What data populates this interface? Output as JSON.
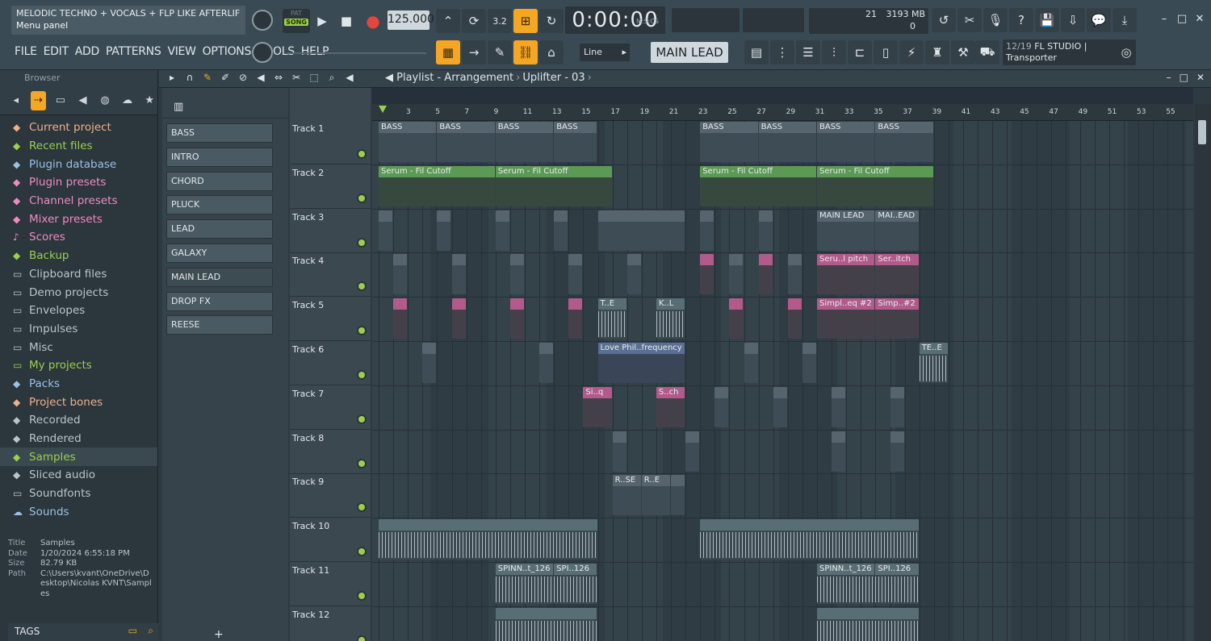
{
  "window": {
    "project_title": "MELODIC TECHNO + VOCALS + FLP LIKE AFTERLIFE,",
    "panel_hint": "Menu panel"
  },
  "transport": {
    "pat_label": "PAT",
    "song_label": "SONG",
    "tempo": "125.000",
    "time": "0:00:00",
    "time_unit": "M:S:CS",
    "cpu_poly": "21",
    "memory": "3193 MB",
    "mem_extra": "0",
    "counter_label": "3.2"
  },
  "menu": [
    "FILE",
    "EDIT",
    "ADD",
    "PATTERNS",
    "VIEW",
    "OPTIONS",
    "TOOLS",
    "HELP"
  ],
  "snap": {
    "value": "Line"
  },
  "sequence": {
    "value": "MAIN LEAD"
  },
  "hint_panel": {
    "counter": "12/19",
    "text1": "FL STUDIO |",
    "text2": "Transporter"
  },
  "browser": {
    "title": "Browser",
    "items": [
      {
        "label": "Current project",
        "icon": "project-icon",
        "color": "#f0b08a"
      },
      {
        "label": "Recent files",
        "icon": "recent-files-icon",
        "color": "#9ccf4e"
      },
      {
        "label": "Plugin database",
        "icon": "plugin-icon",
        "color": "#9bc0e6"
      },
      {
        "label": "Plugin presets",
        "icon": "plugin-presets-icon",
        "color": "#f08bc2"
      },
      {
        "label": "Channel presets",
        "icon": "channel-presets-icon",
        "color": "#f08bc2"
      },
      {
        "label": "Mixer presets",
        "icon": "mixer-presets-icon",
        "color": "#f08bc2"
      },
      {
        "label": "Scores",
        "icon": "note-icon",
        "color": "#f08bc2"
      },
      {
        "label": "Backup",
        "icon": "backup-icon",
        "color": "#9ccf4e"
      },
      {
        "label": "Clipboard files",
        "icon": "folder-icon",
        "color": "#b9c5cb"
      },
      {
        "label": "Demo projects",
        "icon": "folder-icon",
        "color": "#b9c5cb"
      },
      {
        "label": "Envelopes",
        "icon": "folder-icon",
        "color": "#b9c5cb"
      },
      {
        "label": "Impulses",
        "icon": "folder-icon",
        "color": "#b9c5cb"
      },
      {
        "label": "Misc",
        "icon": "folder-icon",
        "color": "#b9c5cb"
      },
      {
        "label": "My projects",
        "icon": "folder-icon",
        "color": "#9ccf4e"
      },
      {
        "label": "Packs",
        "icon": "packs-icon",
        "color": "#9bc0e6"
      },
      {
        "label": "Project bones",
        "icon": "project-bones-icon",
        "color": "#f0b08a"
      },
      {
        "label": "Recorded",
        "icon": "recorded-icon",
        "color": "#b9c5cb"
      },
      {
        "label": "Rendered",
        "icon": "rendered-icon",
        "color": "#b9c5cb"
      },
      {
        "label": "Samples",
        "icon": "samples-icon",
        "color": "#9ccf4e"
      },
      {
        "label": "Sliced audio",
        "icon": "sliced-audio-icon",
        "color": "#b9c5cb"
      },
      {
        "label": "Soundfonts",
        "icon": "folder-icon",
        "color": "#b9c5cb"
      },
      {
        "label": "Sounds",
        "icon": "cloud-icon",
        "color": "#9bc0e6"
      }
    ],
    "selected_index": 18,
    "info": {
      "title_k": "Title",
      "title_v": "Samples",
      "date_k": "Date",
      "date_v": "1/20/2024 6:55:18 PM",
      "size_k": "Size",
      "size_v": "82.79 KB",
      "path_k": "Path",
      "path_v": "C:\\Users\\kvant\\OneDrive\\Desktop\\Nicolas KVNT\\Samples"
    },
    "tags_label": "TAGS"
  },
  "playlist": {
    "title": "Playlist - Arrangement",
    "pattern": "Uplifter - 03",
    "ruler": [
      "3",
      "5",
      "7",
      "9",
      "11",
      "13",
      "15",
      "17",
      "19",
      "21",
      "23",
      "25",
      "27",
      "29",
      "31",
      "33",
      "35",
      "37",
      "39",
      "41",
      "43",
      "45",
      "47",
      "49",
      "51",
      "53",
      "55"
    ],
    "picker": [
      "BASS",
      "INTRO",
      "CHORD",
      "PLUCK",
      "LEAD",
      "GALAXY",
      "MAIN LEAD",
      "DROP FX",
      "REESE"
    ],
    "picker_selected": 6,
    "tracks": [
      "Track 1",
      "Track 2",
      "Track 3",
      "Track 4",
      "Track 5",
      "Track 6",
      "Track 7",
      "Track 8",
      "Track 9",
      "Track 10",
      "Track 11",
      "Track 12"
    ],
    "clips": [
      {
        "track": 0,
        "bar": 1,
        "len": 4,
        "label": "BASS",
        "kind": "pat"
      },
      {
        "track": 0,
        "bar": 5,
        "len": 4,
        "label": "BASS",
        "kind": "pat"
      },
      {
        "track": 0,
        "bar": 9,
        "len": 4,
        "label": "BASS",
        "kind": "pat"
      },
      {
        "track": 0,
        "bar": 13,
        "len": 3,
        "label": "BASS",
        "kind": "pat"
      },
      {
        "track": 0,
        "bar": 23,
        "len": 4,
        "label": "BASS",
        "kind": "pat"
      },
      {
        "track": 0,
        "bar": 27,
        "len": 4,
        "label": "BASS",
        "kind": "pat"
      },
      {
        "track": 0,
        "bar": 31,
        "len": 4,
        "label": "BASS",
        "kind": "pat"
      },
      {
        "track": 0,
        "bar": 35,
        "len": 4,
        "label": "BASS",
        "kind": "pat"
      },
      {
        "track": 1,
        "bar": 1,
        "len": 8,
        "label": "Serum - Fil Cutoff",
        "kind": "auto"
      },
      {
        "track": 1,
        "bar": 9,
        "len": 8,
        "label": "Serum - Fil Cutoff",
        "kind": "auto"
      },
      {
        "track": 1,
        "bar": 23,
        "len": 8,
        "label": "Serum - Fil Cutoff",
        "kind": "auto"
      },
      {
        "track": 1,
        "bar": 31,
        "len": 8,
        "label": "Serum - Fil Cutoff",
        "kind": "auto"
      },
      {
        "track": 2,
        "bar": 1,
        "len": 1,
        "label": "",
        "kind": "pat"
      },
      {
        "track": 2,
        "bar": 5,
        "len": 1,
        "label": "",
        "kind": "pat"
      },
      {
        "track": 2,
        "bar": 9,
        "len": 1,
        "label": "",
        "kind": "pat"
      },
      {
        "track": 2,
        "bar": 13,
        "len": 1,
        "label": "",
        "kind": "pat"
      },
      {
        "track": 2,
        "bar": 16,
        "len": 6,
        "label": "",
        "kind": "pat"
      },
      {
        "track": 2,
        "bar": 23,
        "len": 1,
        "label": "",
        "kind": "pat"
      },
      {
        "track": 2,
        "bar": 27,
        "len": 1,
        "label": "",
        "kind": "pat"
      },
      {
        "track": 2,
        "bar": 31,
        "len": 4,
        "label": "MAIN LEAD",
        "kind": "pat"
      },
      {
        "track": 2,
        "bar": 35,
        "len": 3,
        "label": "MAI..EAD",
        "kind": "pat"
      },
      {
        "track": 3,
        "bar": 2,
        "len": 1,
        "label": "",
        "kind": "pat"
      },
      {
        "track": 3,
        "bar": 6,
        "len": 1,
        "label": "",
        "kind": "pat"
      },
      {
        "track": 3,
        "bar": 10,
        "len": 1,
        "label": "",
        "kind": "pat"
      },
      {
        "track": 3,
        "bar": 14,
        "len": 1,
        "label": "",
        "kind": "pat"
      },
      {
        "track": 3,
        "bar": 18,
        "len": 1,
        "label": "",
        "kind": "pat"
      },
      {
        "track": 3,
        "bar": 23,
        "len": 1,
        "label": "",
        "kind": "pink"
      },
      {
        "track": 3,
        "bar": 25,
        "len": 1,
        "label": "",
        "kind": "pat"
      },
      {
        "track": 3,
        "bar": 27,
        "len": 1,
        "label": "",
        "kind": "pink"
      },
      {
        "track": 3,
        "bar": 29,
        "len": 1,
        "label": "",
        "kind": "pat"
      },
      {
        "track": 3,
        "bar": 31,
        "len": 4,
        "label": "Seru..l pitch",
        "kind": "pink"
      },
      {
        "track": 3,
        "bar": 35,
        "len": 3,
        "label": "Ser..itch",
        "kind": "pink"
      },
      {
        "track": 4,
        "bar": 2,
        "len": 1,
        "label": "",
        "kind": "pink"
      },
      {
        "track": 4,
        "bar": 6,
        "len": 1,
        "label": "",
        "kind": "pink"
      },
      {
        "track": 4,
        "bar": 10,
        "len": 1,
        "label": "",
        "kind": "pink"
      },
      {
        "track": 4,
        "bar": 14,
        "len": 1,
        "label": "",
        "kind": "pink"
      },
      {
        "track": 4,
        "bar": 16,
        "len": 2,
        "label": "T..E",
        "kind": "audio"
      },
      {
        "track": 4,
        "bar": 20,
        "len": 2,
        "label": "K..L",
        "kind": "audio"
      },
      {
        "track": 4,
        "bar": 25,
        "len": 1,
        "label": "",
        "kind": "pink"
      },
      {
        "track": 4,
        "bar": 29,
        "len": 1,
        "label": "",
        "kind": "pink"
      },
      {
        "track": 4,
        "bar": 31,
        "len": 4,
        "label": "Simpl..eq #2",
        "kind": "pink"
      },
      {
        "track": 4,
        "bar": 35,
        "len": 3,
        "label": "Simp..#2",
        "kind": "pink"
      },
      {
        "track": 5,
        "bar": 4,
        "len": 1,
        "label": "",
        "kind": "pat"
      },
      {
        "track": 5,
        "bar": 12,
        "len": 1,
        "label": "",
        "kind": "pat"
      },
      {
        "track": 5,
        "bar": 16,
        "len": 6,
        "label": "Love Phil..frequency",
        "kind": "blue"
      },
      {
        "track": 5,
        "bar": 26,
        "len": 1,
        "label": "",
        "kind": "pat"
      },
      {
        "track": 5,
        "bar": 30,
        "len": 1,
        "label": "",
        "kind": "pat"
      },
      {
        "track": 5,
        "bar": 38,
        "len": 2,
        "label": "TE..E",
        "kind": "audio"
      },
      {
        "track": 6,
        "bar": 15,
        "len": 2,
        "label": "Si..q",
        "kind": "pink"
      },
      {
        "track": 6,
        "bar": 20,
        "len": 2,
        "label": "S..ch",
        "kind": "pink"
      },
      {
        "track": 6,
        "bar": 24,
        "len": 1,
        "label": "",
        "kind": "pat"
      },
      {
        "track": 6,
        "bar": 28,
        "len": 1,
        "label": "",
        "kind": "pat"
      },
      {
        "track": 6,
        "bar": 32,
        "len": 1,
        "label": "",
        "kind": "pat"
      },
      {
        "track": 6,
        "bar": 36,
        "len": 1,
        "label": "",
        "kind": "pat"
      },
      {
        "track": 7,
        "bar": 17,
        "len": 1,
        "label": "",
        "kind": "pat"
      },
      {
        "track": 7,
        "bar": 22,
        "len": 1,
        "label": "",
        "kind": "pat"
      },
      {
        "track": 7,
        "bar": 32,
        "len": 1,
        "label": "",
        "kind": "pat"
      },
      {
        "track": 7,
        "bar": 36,
        "len": 1,
        "label": "",
        "kind": "pat"
      },
      {
        "track": 8,
        "bar": 17,
        "len": 2,
        "label": "R..SE",
        "kind": "pat"
      },
      {
        "track": 8,
        "bar": 19,
        "len": 2,
        "label": "R..E",
        "kind": "pat"
      },
      {
        "track": 8,
        "bar": 21,
        "len": 1,
        "label": "",
        "kind": "pat"
      },
      {
        "track": 9,
        "bar": 1,
        "len": 15,
        "label": "",
        "kind": "audio"
      },
      {
        "track": 9,
        "bar": 23,
        "len": 15,
        "label": "",
        "kind": "audio"
      },
      {
        "track": 10,
        "bar": 9,
        "len": 4,
        "label": "SPINN..t_126",
        "kind": "audio"
      },
      {
        "track": 10,
        "bar": 13,
        "len": 3,
        "label": "SPI..126",
        "kind": "audio"
      },
      {
        "track": 10,
        "bar": 31,
        "len": 4,
        "label": "SPINN..t_126",
        "kind": "audio"
      },
      {
        "track": 10,
        "bar": 35,
        "len": 3,
        "label": "SPI..126",
        "kind": "audio"
      },
      {
        "track": 11,
        "bar": 9,
        "len": 7,
        "label": "",
        "kind": "audio"
      },
      {
        "track": 11,
        "bar": 31,
        "len": 7,
        "label": "",
        "kind": "audio"
      }
    ]
  }
}
